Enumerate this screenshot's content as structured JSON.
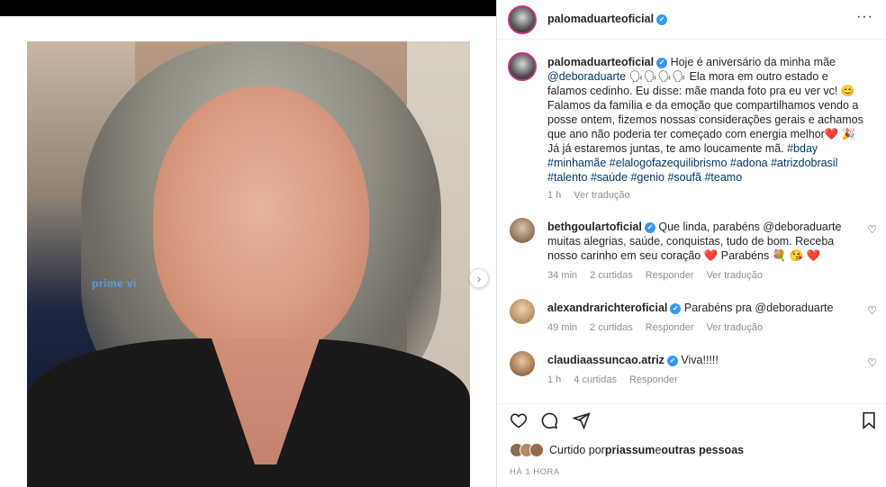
{
  "post": {
    "username": "palomaduarteoficial",
    "more_label": "···"
  },
  "photo": {
    "overlay_text": "prime vi"
  },
  "caption": {
    "username": "palomaduarteoficial",
    "text_1": " Hoje é aniversário da minha mãe ",
    "mention": "@deboraduarte",
    "text_2": " 🗣🗣🗣🗣 Ela mora em outro estado e falamos cedinho. Eu disse: mãe manda foto pra eu ver vc! 😊 Falamos da família e da emoção que compartilhamos vendo a posse ontem, fizemos nossas considerações gerais e achamos que ano não poderia ter começado com energia melhor❤️ 🎉 Já já estaremos juntas, te amo loucamente mã. ",
    "hashtags": "#bday #minhamãe #elalogofazequilibrismo #adona #atrizdobrasil #talento #saúde #genio #soufã #teamo",
    "time": "1 h",
    "translate": "Ver tradução"
  },
  "comments": [
    {
      "username": "bethgoulartoficial",
      "text": " Que linda, parabéns ",
      "mention": "@deboraduarte",
      "text_after": " muitas alegrias, saúde, conquistas, tudo de bom. Receba nosso carinho em seu coração ❤️ Parabéns 💐 😘 ❤️",
      "time": "34 min",
      "likes": "2 curtidas",
      "reply": "Responder",
      "translate": "Ver tradução"
    },
    {
      "username": "alexandrarichteroficial",
      "text": " Parabéns pra ",
      "mention": "@deboraduarte",
      "text_after": "",
      "time": "49 min",
      "likes": "2 curtidas",
      "reply": "Responder",
      "translate": "Ver tradução"
    },
    {
      "username": "claudiaassuncao.atriz",
      "text": " Viva!!!!!",
      "mention": "",
      "text_after": "",
      "time": "1 h",
      "likes": "4 curtidas",
      "reply": "Responder",
      "translate": ""
    }
  ],
  "likes": {
    "prefix": "Curtido por ",
    "user": "priassum",
    "middle": " e ",
    "others": "outras pessoas"
  },
  "time_ago": "HÁ 1 HORA",
  "icons": {
    "like": "heart-outline-icon",
    "comment": "comment-bubble-icon",
    "share": "paper-plane-icon",
    "save": "bookmark-icon",
    "verified": "verified-badge-icon",
    "next": "chevron-right-icon"
  },
  "colors": {
    "verified": "#3897f0",
    "link": "#00376b",
    "muted": "#8e8e8e"
  }
}
